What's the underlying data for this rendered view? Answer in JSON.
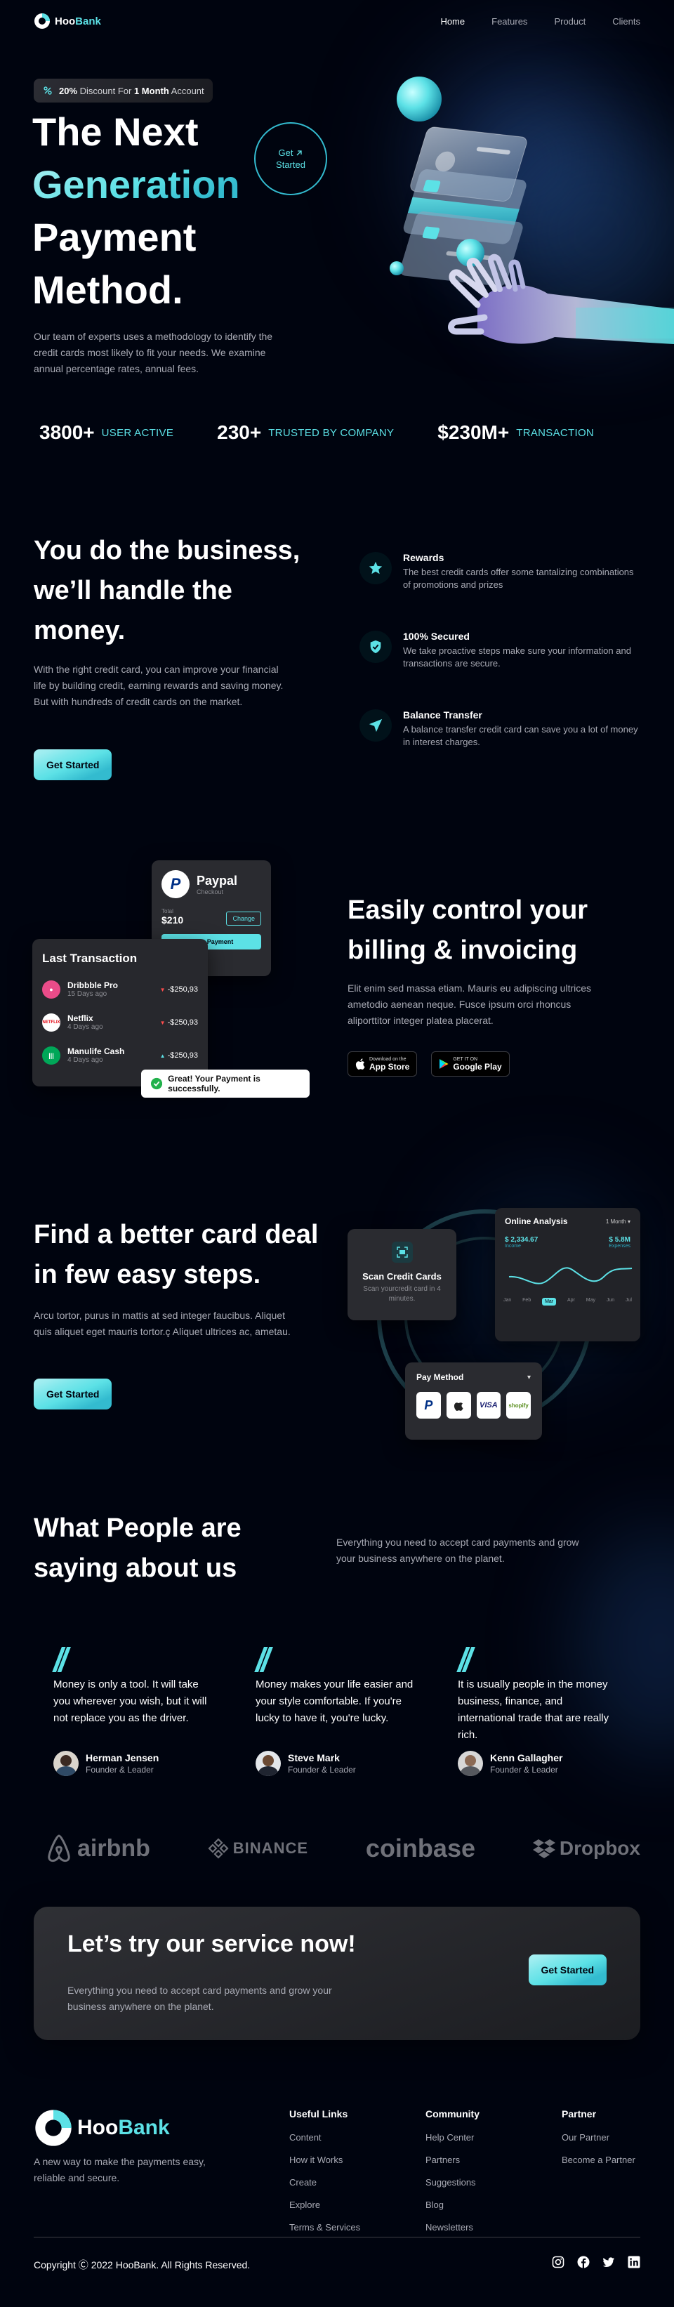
{
  "brand": {
    "name_a": "Hoo",
    "name_b": "Bank"
  },
  "nav": {
    "items": [
      "Home",
      "Features",
      "Product",
      "Clients"
    ],
    "active": "Home"
  },
  "hero": {
    "badge_pct": "20%",
    "badge_text_a": " Discount For ",
    "badge_bold": "1 Month",
    "badge_text_b": " Account",
    "title_line1": "The Next",
    "title_line2": "Generation",
    "title_line3": "Payment",
    "title_line4": "Method.",
    "circle_line1": "Get",
    "circle_line2": "Started",
    "description": "Our team of experts uses a methodology to identify the credit cards most likely to fit your needs. We examine annual percentage rates, annual fees."
  },
  "stats": [
    {
      "value": "3800+",
      "label": "USER ACTIVE"
    },
    {
      "value": "230+",
      "label": "TRUSTED BY COMPANY"
    },
    {
      "value": "$230M+",
      "label": "TRANSACTION"
    }
  ],
  "business": {
    "title": "You do the business, we’ll handle the money.",
    "description": "With the right credit card, you can improve your financial life by building credit, earning rewards and saving money. But with hundreds of credit cards on the market.",
    "button": "Get Started",
    "features": [
      {
        "icon": "star-icon",
        "title": "Rewards",
        "desc": "The best credit cards offer some tantalizing combinations of promotions and prizes"
      },
      {
        "icon": "shield-icon",
        "title": "100% Secured",
        "desc": "We take proactive steps make sure your information and transactions are secure."
      },
      {
        "icon": "send-icon",
        "title": "Balance Transfer",
        "desc": "A balance transfer credit card can save you a lot of money in interest charges."
      }
    ]
  },
  "billing": {
    "paypal": {
      "title": "Paypal",
      "sub": "Checkout",
      "total_label": "Total",
      "total": "$210",
      "change": "Change",
      "make_payment": "Make Payment"
    },
    "last_transaction": {
      "title": "Last Transaction",
      "rows": [
        {
          "name": "Dribbble Pro",
          "time": "15 Days ago",
          "amount": "-$250,93",
          "color": "#ea4c89",
          "dir": "down"
        },
        {
          "name": "Netflix",
          "time": "4 Days ago",
          "amount": "-$250,93",
          "color": "#e50914",
          "dir": "down"
        },
        {
          "name": "Manulife Cash",
          "time": "4 Days ago",
          "amount": "-$250,93",
          "color": "#00a758",
          "dir": "up"
        }
      ]
    },
    "toast": "Great! Your Payment is successfully.",
    "title": "Easily control your billing & invoicing",
    "description": "Elit enim sed massa etiam. Mauris eu adipiscing ultrices ametodio aenean neque. Fusce ipsum orci rhoncus aliporttitor integer platea placerat.",
    "appstore_small": "Download on the",
    "appstore_big": "App Store",
    "googleplay_small": "GET IT ON",
    "googleplay_big": "Google Play"
  },
  "carddeal": {
    "title": "Find a better card deal in few easy steps.",
    "description": "Arcu tortor, purus in mattis at sed integer faucibus. Aliquet quis aliquet eget mauris tortor.ç Aliquet ultrices ac, ametau.",
    "button": "Get Started",
    "scan": {
      "title": "Scan Credit Cards",
      "sub": "Scan yourcredit card in 4 minutes."
    },
    "analysis": {
      "title": "Online Analysis",
      "period": "1 Month",
      "v1": "$ 2,334.67",
      "v1_label": "Income",
      "v2": "$ 5.8M",
      "v2_label": "Expenses",
      "months": [
        "Jan",
        "Feb",
        "Mar",
        "Apr",
        "May",
        "Jun",
        "Jul"
      ],
      "active_month": "Mar"
    },
    "paymethod": {
      "title": "Pay Method",
      "options": [
        "paypal-icon",
        "apple-icon",
        "visa-icon",
        "shopify-icon"
      ]
    }
  },
  "testimonials": {
    "title": "What People are saying about us",
    "description": "Everything you need to accept card payments and grow your business anywhere on the planet.",
    "items": [
      {
        "quote": "Money is only a tool. It will take you wherever you wish, but it will not replace you as the driver.",
        "name": "Herman Jensen",
        "role": "Founder & Leader"
      },
      {
        "quote": "Money makes your life easier and your style comfortable. If you're lucky to have it, you're lucky.",
        "name": "Steve Mark",
        "role": "Founder & Leader"
      },
      {
        "quote": "It is usually people in the money business, finance, and international trade that are really rich.",
        "name": "Kenn Gallagher",
        "role": "Founder & Leader"
      }
    ]
  },
  "clients": [
    "airbnb",
    "BINANCE",
    "coinbase",
    "Dropbox"
  ],
  "cta": {
    "title": "Let’s try our service now!",
    "description": "Everything you need to accept card payments and grow your business anywhere on the planet.",
    "button": "Get Started"
  },
  "footer": {
    "tagline": "A new way to make the payments easy, reliable and secure.",
    "columns": [
      {
        "title": "Useful Links",
        "links": [
          "Content",
          "How it Works",
          "Create",
          "Explore",
          "Terms & Services"
        ]
      },
      {
        "title": "Community",
        "links": [
          "Help Center",
          "Partners",
          "Suggestions",
          "Blog",
          "Newsletters"
        ]
      },
      {
        "title": "Partner",
        "links": [
          "Our Partner",
          "Become a Partner"
        ]
      }
    ],
    "copyright": "Copyright Ⓒ 2022 HooBank. All Rights Reserved.",
    "social": [
      "instagram-icon",
      "facebook-icon",
      "twitter-icon",
      "linkedin-icon"
    ]
  },
  "colors": {
    "background": "#00040f",
    "accent": "#5ce1e6",
    "accent_dark": "#33bbcf",
    "text_dim": "#a8aab4"
  }
}
